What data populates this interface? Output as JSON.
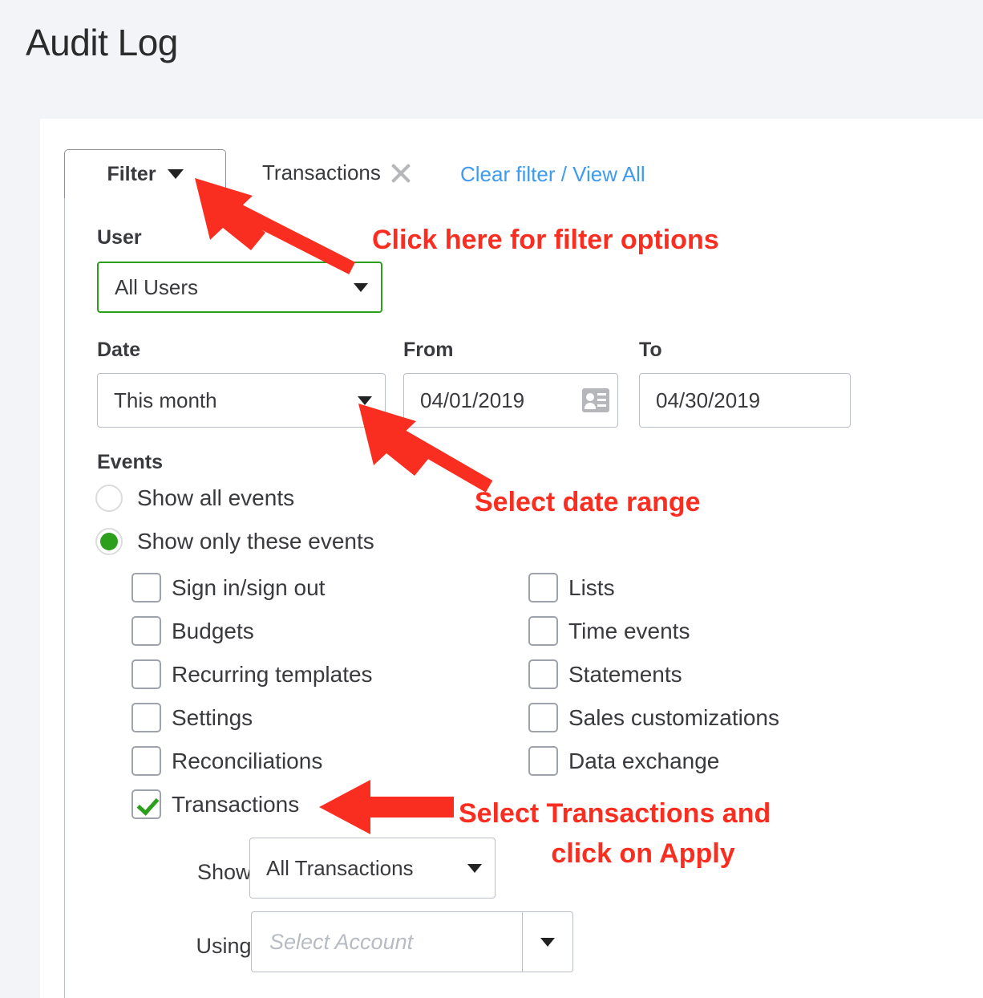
{
  "page": {
    "title": "Audit Log"
  },
  "filter_bar": {
    "filter_button_label": "Filter",
    "active_chip_label": "Transactions",
    "remove_chip_icon": "close-icon",
    "clear_link_label": "Clear filter / View All",
    "link_color": "#3d9bf0"
  },
  "panel": {
    "user": {
      "label": "User",
      "value": "All Users",
      "focus_border_color": "#2ca01c"
    },
    "date": {
      "label": "Date",
      "value": "This month"
    },
    "from": {
      "label": "From",
      "value": "04/01/2019",
      "icon": "id-card-icon"
    },
    "to": {
      "label": "To",
      "value": "04/30/2019"
    },
    "events": {
      "title": "Events",
      "radios": [
        {
          "label": "Show all events",
          "checked": false
        },
        {
          "label": "Show only these events",
          "checked": true
        }
      ],
      "checkboxes_left": [
        {
          "label": "Sign in/sign out",
          "checked": false
        },
        {
          "label": "Budgets",
          "checked": false
        },
        {
          "label": "Recurring templates",
          "checked": false
        },
        {
          "label": "Settings",
          "checked": false
        },
        {
          "label": "Reconciliations",
          "checked": false
        },
        {
          "label": "Transactions",
          "checked": true
        }
      ],
      "checkboxes_right": [
        {
          "label": "Lists",
          "checked": false
        },
        {
          "label": "Time events",
          "checked": false
        },
        {
          "label": "Statements",
          "checked": false
        },
        {
          "label": "Sales customizations",
          "checked": false
        },
        {
          "label": "Data exchange",
          "checked": false
        }
      ]
    },
    "show": {
      "label": "Show:",
      "value": "All Transactions"
    },
    "using": {
      "label": "Using:",
      "placeholder": "Select Account",
      "value": ""
    }
  },
  "annotations": {
    "color": "#fa2e20",
    "items": [
      {
        "text": "Click here for filter options"
      },
      {
        "text": "Select date range"
      },
      {
        "text": "Select Transactions and"
      },
      {
        "text": "click on Apply"
      }
    ]
  }
}
